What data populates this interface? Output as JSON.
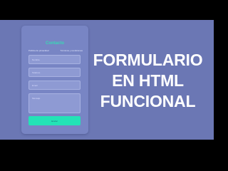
{
  "card": {
    "title": "Contacto",
    "links": [
      "Política de privacidad",
      "Términos y condiciones"
    ],
    "fields": [
      "Nombre",
      "Teléfono",
      "Email",
      "Mensaje"
    ],
    "button": "Enviar"
  },
  "headline": [
    "FORMULARIO",
    "EN HTML",
    "FUNCIONAL"
  ],
  "colors": {
    "background": "#6b77b4",
    "card": "#7885c4",
    "accent": "#23e3b6"
  }
}
